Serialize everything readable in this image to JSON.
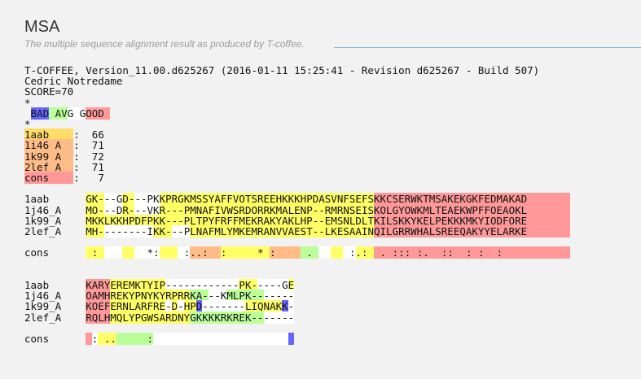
{
  "page": {
    "title": "MSA",
    "subtitle": "The multiple sequence alignment result as produced by T-coffee."
  },
  "palette": {
    "0": "#ffffff",
    "1": "#6666ff",
    "2": "#66ff66",
    "3": "#bbff99",
    "4": "#ffff66",
    "5": "#ffdd66",
    "6": "#ffbb88",
    "7": "#ff9999"
  },
  "alignment": {
    "lines": [
      "T-COFFEE, Version_11.00.d625267 (2016-01-11 15:25:41 - Revision d625267 - Build 507)",
      "Cedric Notredame",
      "SCORE=70",
      "*",
      " BAD AVG GOOD",
      "*",
      "1aab    :  66",
      "1i46_A  :  71",
      "1k99_A  :  72",
      "2lef_A  :  71",
      "cons    :   7",
      "",
      "1aab      GK---GD---PKKPRGKMSSYAFFVOTSREEHKKKHPDASVNFSEFSKKCSERWKTMSAKEKGKFEDMAKAD",
      "1j46_A    MO---DR---VKR---PMNAFIVWSRDORRKMALENP--RMRNSEISKOLGYOWKMLTEAEKWPFFOEAOKL",
      "1k99_A    MKKLKKHPDFPKK---PLTPYFRFFMEKRAKYAKLHP--EMSNLDLTKILSKKYKELPEKKKMKYIODFORE",
      "2lef_A    MH--------IKK---PLNAFMLYMKEMRANVVAEST--LKESAAINQILGRRWHALSREEQAKYYELARKE",
      "",
      "cons       :        *:    :..:  :     * :     .      :.:  . ::: :.  ::  : :  :",
      "",
      "",
      "1aab      KARYEREMKTYIP------------PK-----GE",
      "1j46_A    OAMHREKYPNYKYRPRRKA---KMLPK-------",
      "1k99_A    KOEFERNLARFRE-D-HPD-------LIQNAKK-",
      "2lef_A    RQLHMQLYPGWSARDNYGKKKKRKREK-------",
      "",
      "cons       : ..     :                        "
    ],
    "colors": [
      "",
      "",
      "",
      "",
      " 1113330007777",
      "",
      "55555555",
      "66666666",
      "66666666",
      "66666666",
      "77777777",
      "",
      "          4440004400004444444444444444444444444444444444477777777777777777777777777777777",
      "          4440004400004444444444444444444444444444444444477777777777777777777777777777777",
      "          4444444444444444444444444444444444444444444444477777777777777777777777777777777",
      "          4440000000044400044444444444444444444444444444477777777777777777777777777777777",
      "",
      "          4440004400004440066666444444446666633300440044477777777777777777777777777777777",
      "",
      "",
      "          7777444444444000000000000444000004",
      "          7777444444444444433300033333300000",
      "          7777444444444040441000000044444410",
      "          7777444444444444433333333333300000",
      "",
      "          7044433333300000000000000000000001"
    ]
  }
}
